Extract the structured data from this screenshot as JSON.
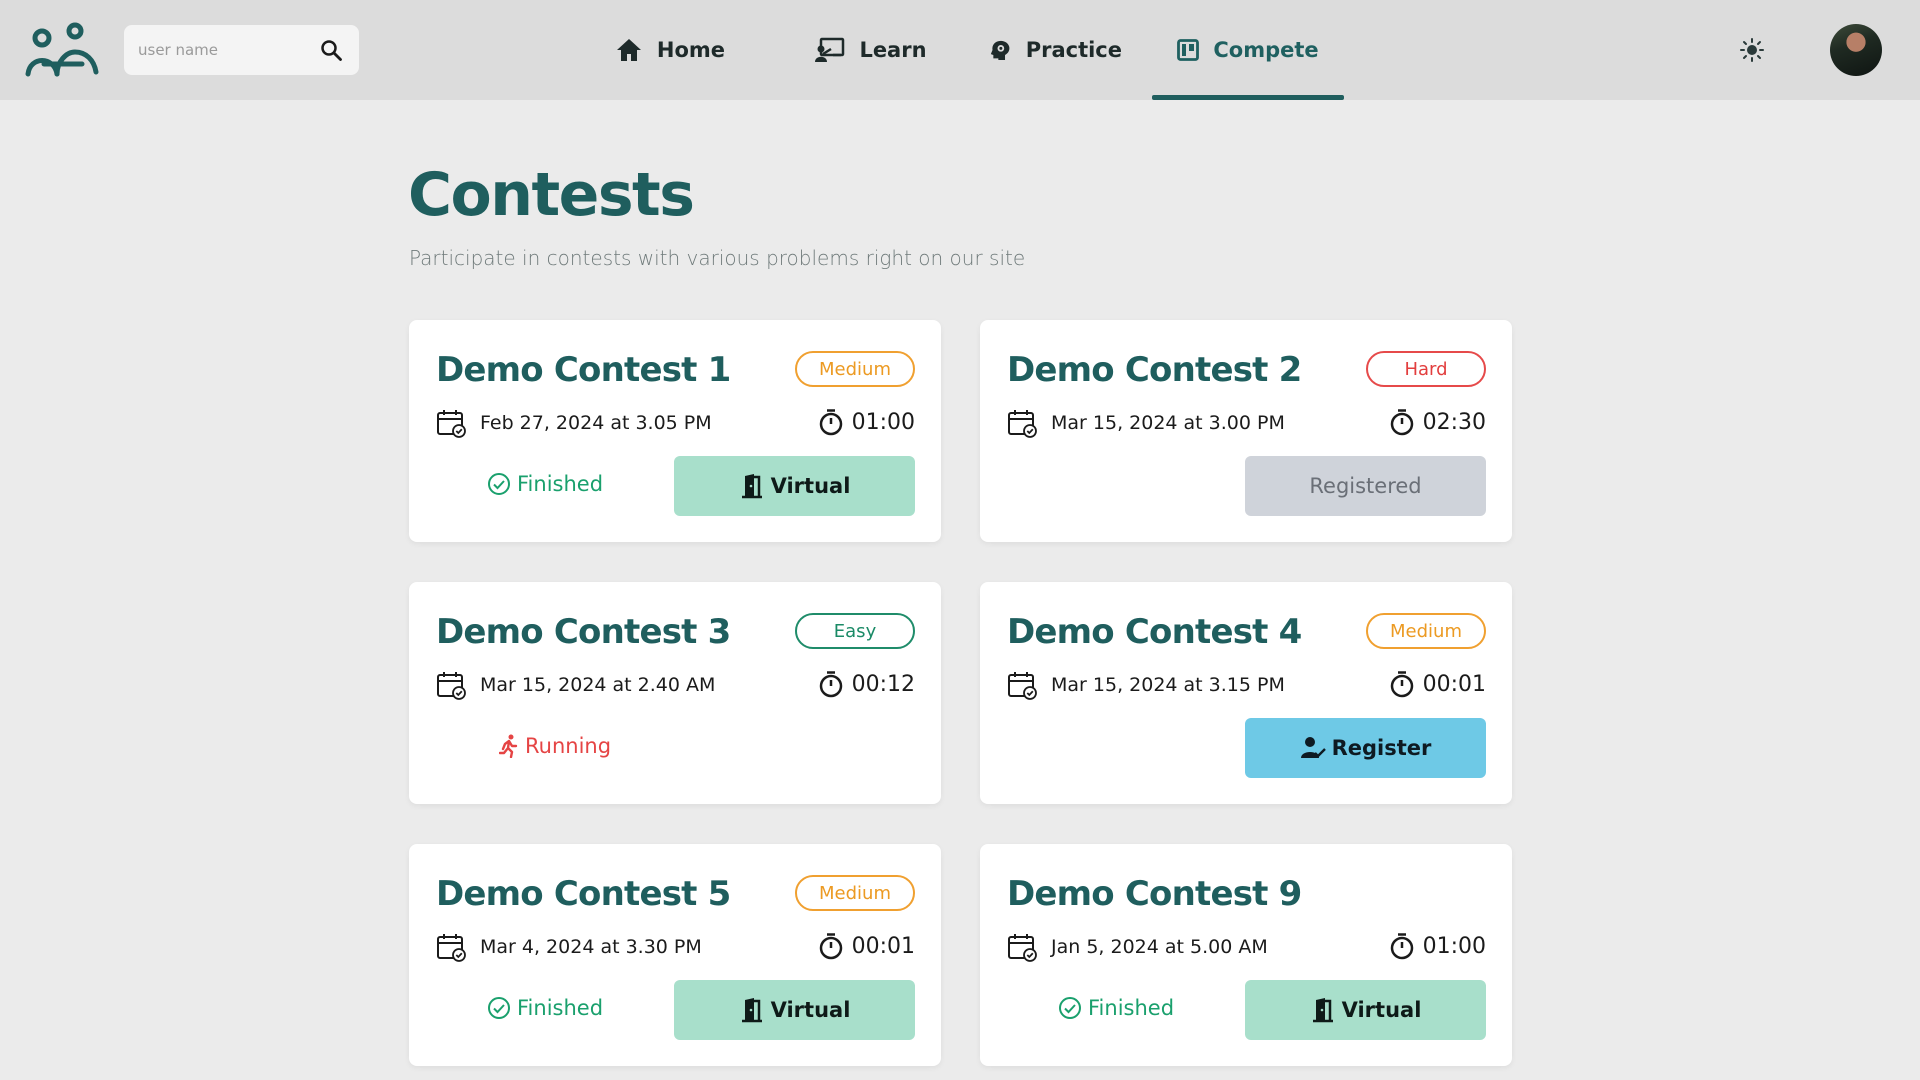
{
  "search": {
    "placeholder": "user name"
  },
  "nav": {
    "home": "Home",
    "learn": "Learn",
    "practice": "Practice",
    "compete": "Compete"
  },
  "header": {
    "title": "Contests",
    "subtitle": "Participate in contests with various problems right on our site"
  },
  "icons": {
    "logo": "people-logo-icon",
    "search": "search-icon",
    "theme": "sun-icon",
    "calendar": "calendar-check-icon",
    "timer": "stopwatch-icon",
    "finished": "check-circle-icon",
    "running": "running-person-icon",
    "virtual": "door-open-icon",
    "register": "user-check-icon"
  },
  "colors": {
    "primary": "#1f5e5e",
    "medium": "#ec9a22",
    "hard": "#e23e3e",
    "easy": "#1a8a66",
    "finished": "#1aa06d",
    "running": "#e54444",
    "virtual_bg": "#a8dfcb",
    "registered_bg": "#cfd3da",
    "register_bg": "#6ec9e6"
  },
  "contests": [
    {
      "title": "Demo Contest 1",
      "difficulty": "Medium",
      "date": "Feb 27, 2024 at 3.05 PM",
      "duration": "01:00",
      "status": "Finished",
      "action": "Virtual"
    },
    {
      "title": "Demo Contest 2",
      "difficulty": "Hard",
      "date": "Mar 15, 2024 at 3.00 PM",
      "duration": "02:30",
      "status": "",
      "action": "Registered"
    },
    {
      "title": "Demo Contest 3",
      "difficulty": "Easy",
      "date": "Mar 15, 2024 at 2.40 AM",
      "duration": "00:12",
      "status": "Running",
      "action": ""
    },
    {
      "title": "Demo Contest 4",
      "difficulty": "Medium",
      "date": "Mar 15, 2024 at 3.15 PM",
      "duration": "00:01",
      "status": "",
      "action": "Register"
    },
    {
      "title": "Demo Contest 5",
      "difficulty": "Medium",
      "date": "Mar 4, 2024 at 3.30 PM",
      "duration": "00:01",
      "status": "Finished",
      "action": "Virtual"
    },
    {
      "title": "Demo Contest 9",
      "difficulty": "",
      "date": "Jan 5, 2024 at 5.00 AM",
      "duration": "01:00",
      "status": "Finished",
      "action": "Virtual"
    }
  ]
}
